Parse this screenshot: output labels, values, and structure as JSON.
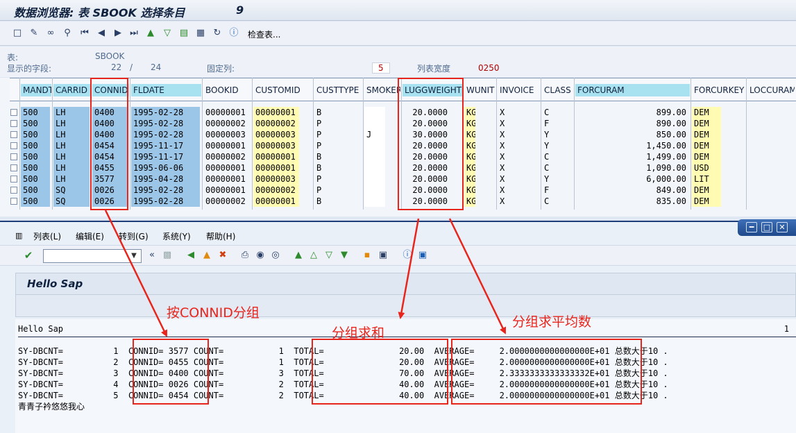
{
  "title": {
    "text": "数据浏览器: 表 SBOOK 选择条目",
    "count": "9"
  },
  "toolbar": {
    "check_table": "检查表..."
  },
  "info": {
    "table_label": "表:",
    "table_name": "SBOOK",
    "fields_label": "显示的字段:",
    "fields_shown": "22",
    "fields_sep": "/",
    "fields_total": "24",
    "fixed_label": "固定列:",
    "fixed_value": "5",
    "width_label": "列表宽度",
    "width_value": "0250"
  },
  "table": {
    "columns": [
      "MANDT",
      "CARRID",
      "CONNID",
      "FLDATE",
      "BOOKID",
      "CUSTOMID",
      "CUSTTYPE",
      "SMOKER",
      "LUGGWEIGHT",
      "WUNIT",
      "INVOICE",
      "CLASS",
      "FORCURAM",
      "FORCURKEY",
      "LOCCURAM"
    ],
    "rows": [
      [
        "500",
        "LH",
        "0400",
        "1995-02-28",
        "00000001",
        "00000001",
        "B",
        "",
        "20.0000",
        "KG",
        "X",
        "C",
        "899.00",
        "DEM"
      ],
      [
        "500",
        "LH",
        "0400",
        "1995-02-28",
        "00000002",
        "00000002",
        "P",
        "",
        "20.0000",
        "KG",
        "X",
        "F",
        "890.00",
        "DEM"
      ],
      [
        "500",
        "LH",
        "0400",
        "1995-02-28",
        "00000003",
        "00000003",
        "P",
        "J",
        "30.0000",
        "KG",
        "X",
        "Y",
        "850.00",
        "DEM"
      ],
      [
        "500",
        "LH",
        "0454",
        "1995-11-17",
        "00000001",
        "00000003",
        "P",
        "",
        "20.0000",
        "KG",
        "X",
        "Y",
        "1,450.00",
        "DEM"
      ],
      [
        "500",
        "LH",
        "0454",
        "1995-11-17",
        "00000002",
        "00000001",
        "B",
        "",
        "20.0000",
        "KG",
        "X",
        "C",
        "1,499.00",
        "DEM"
      ],
      [
        "500",
        "LH",
        "0455",
        "1995-06-06",
        "00000001",
        "00000001",
        "B",
        "",
        "20.0000",
        "KG",
        "X",
        "C",
        "1,090.00",
        "USD"
      ],
      [
        "500",
        "LH",
        "3577",
        "1995-04-28",
        "00000001",
        "00000003",
        "P",
        "",
        "20.0000",
        "KG",
        "X",
        "Y",
        "6,000.00",
        "LIT"
      ],
      [
        "500",
        "SQ",
        "0026",
        "1995-02-28",
        "00000001",
        "00000002",
        "P",
        "",
        "20.0000",
        "KG",
        "X",
        "F",
        "849.00",
        "DEM"
      ],
      [
        "500",
        "SQ",
        "0026",
        "1995-02-28",
        "00000002",
        "00000001",
        "B",
        "",
        "20.0000",
        "KG",
        "X",
        "C",
        "835.00",
        "DEM"
      ]
    ]
  },
  "menu": {
    "list": "列表(L)",
    "edit": "编辑(E)",
    "goto": "转到(G)",
    "system": "系统(Y)",
    "help": "帮助(H)"
  },
  "report": {
    "title": "Hello Sap",
    "hello_line": "Hello Sap",
    "page": "1",
    "lines": [
      "SY-DBCNT=          1  CONNID= 3577 COUNT=           1  TOTAL=               20.00  AVERAGE=     2.0000000000000000E+01 总数大于10 .",
      "SY-DBCNT=          2  CONNID= 0455 COUNT=           1  TOTAL=               20.00  AVERAGE=     2.0000000000000000E+01 总数大于10 .",
      "SY-DBCNT=          3  CONNID= 0400 COUNT=           3  TOTAL=               70.00  AVERAGE=     2.3333333333333332E+01 总数大于10 .",
      "SY-DBCNT=          4  CONNID= 0026 COUNT=           2  TOTAL=               40.00  AVERAGE=     2.0000000000000000E+01 总数大于10 .",
      "SY-DBCNT=          5  CONNID= 0454 COUNT=           2  TOTAL=               40.00  AVERAGE=     2.0000000000000000E+01 总数大于10 ."
    ],
    "footer": "青青子衿悠悠我心"
  },
  "annotations": {
    "group_connid": "按CONNID分组",
    "group_sum": "分组求和",
    "group_avg": "分组求平均数",
    "color": "#e8251d"
  }
}
